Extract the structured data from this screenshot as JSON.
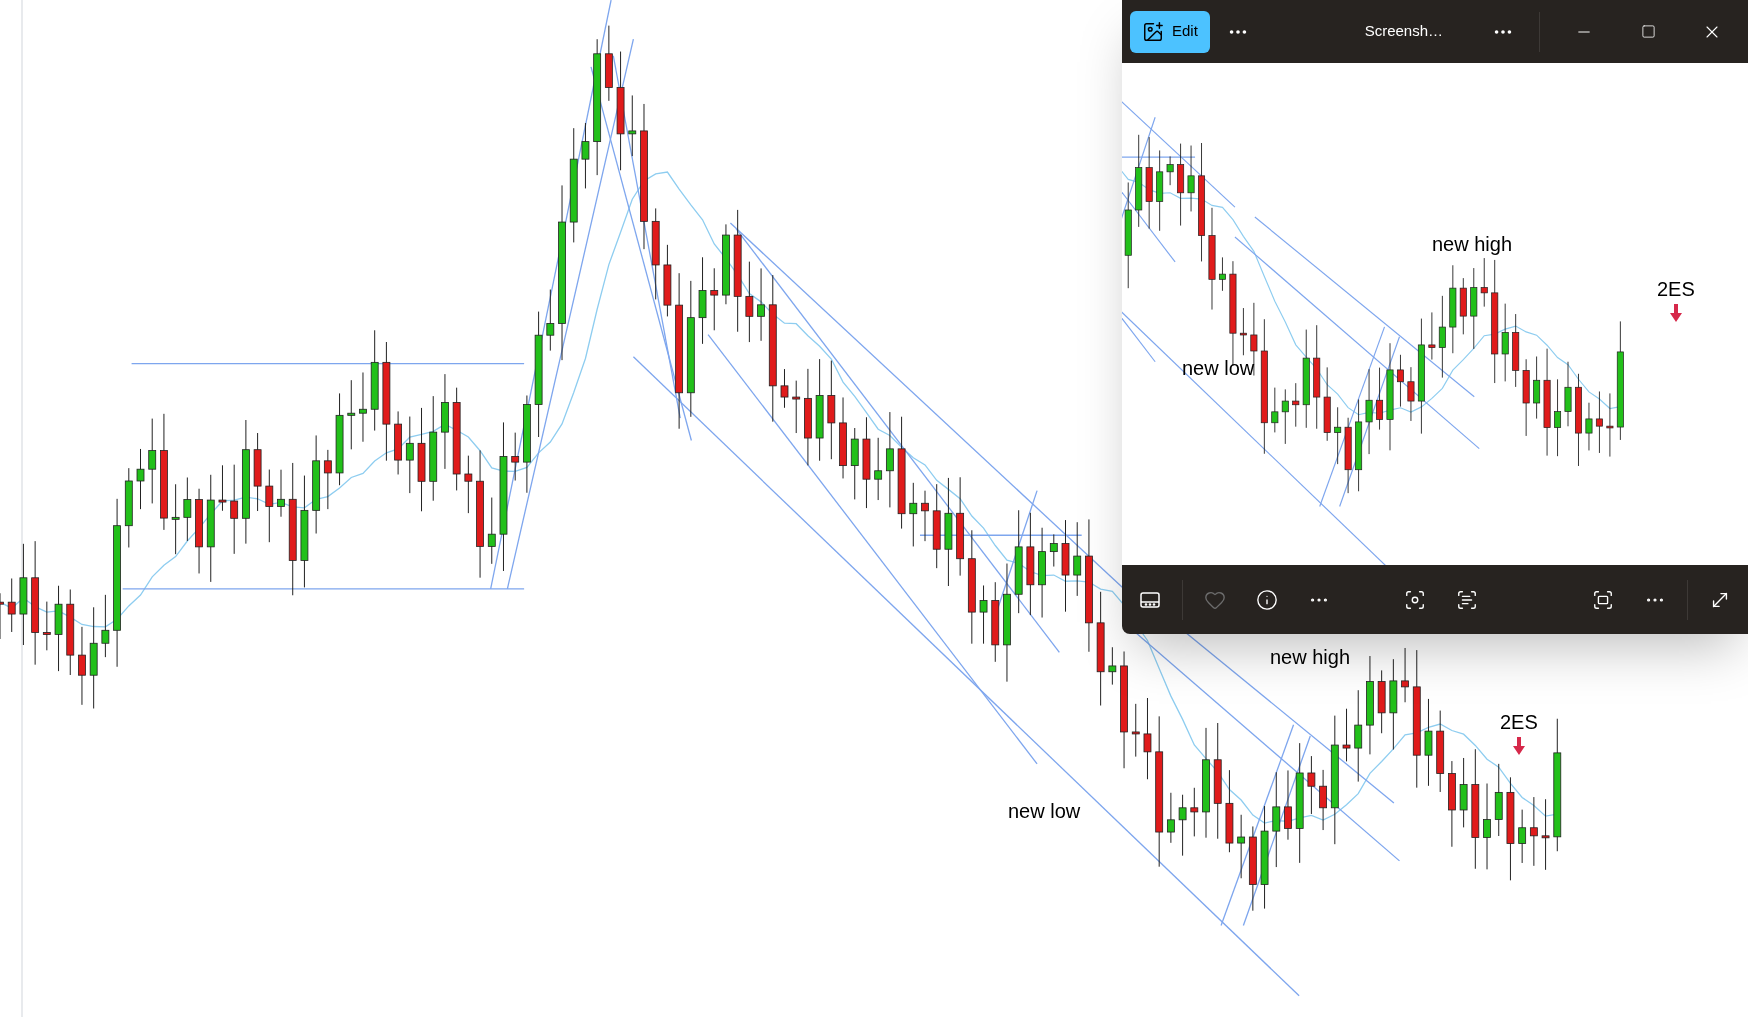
{
  "chart_labels": [
    {
      "text": "new low",
      "kind": "plain"
    },
    {
      "text": "new high",
      "kind": "plain"
    },
    {
      "text": "2ES",
      "kind": "signal"
    }
  ],
  "window": {
    "edit_button": "Edit",
    "title": "Screensh…"
  },
  "preview_labels": [
    {
      "text": "new high",
      "kind": "plain"
    },
    {
      "text": "new low",
      "kind": "plain"
    },
    {
      "text": "2ES",
      "kind": "signal"
    }
  ],
  "toolbar": [
    {
      "kind": "filmstrip",
      "disabled": false
    },
    {
      "kind": "favorite",
      "disabled": true
    },
    {
      "kind": "info",
      "disabled": false
    },
    {
      "kind": "more",
      "disabled": false
    },
    {
      "kind": "visual-search",
      "disabled": false
    },
    {
      "kind": "text-scan",
      "disabled": false
    },
    {
      "kind": "fit",
      "disabled": false
    },
    {
      "kind": "more",
      "disabled": false
    },
    {
      "kind": "expand",
      "disabled": false
    }
  ]
}
